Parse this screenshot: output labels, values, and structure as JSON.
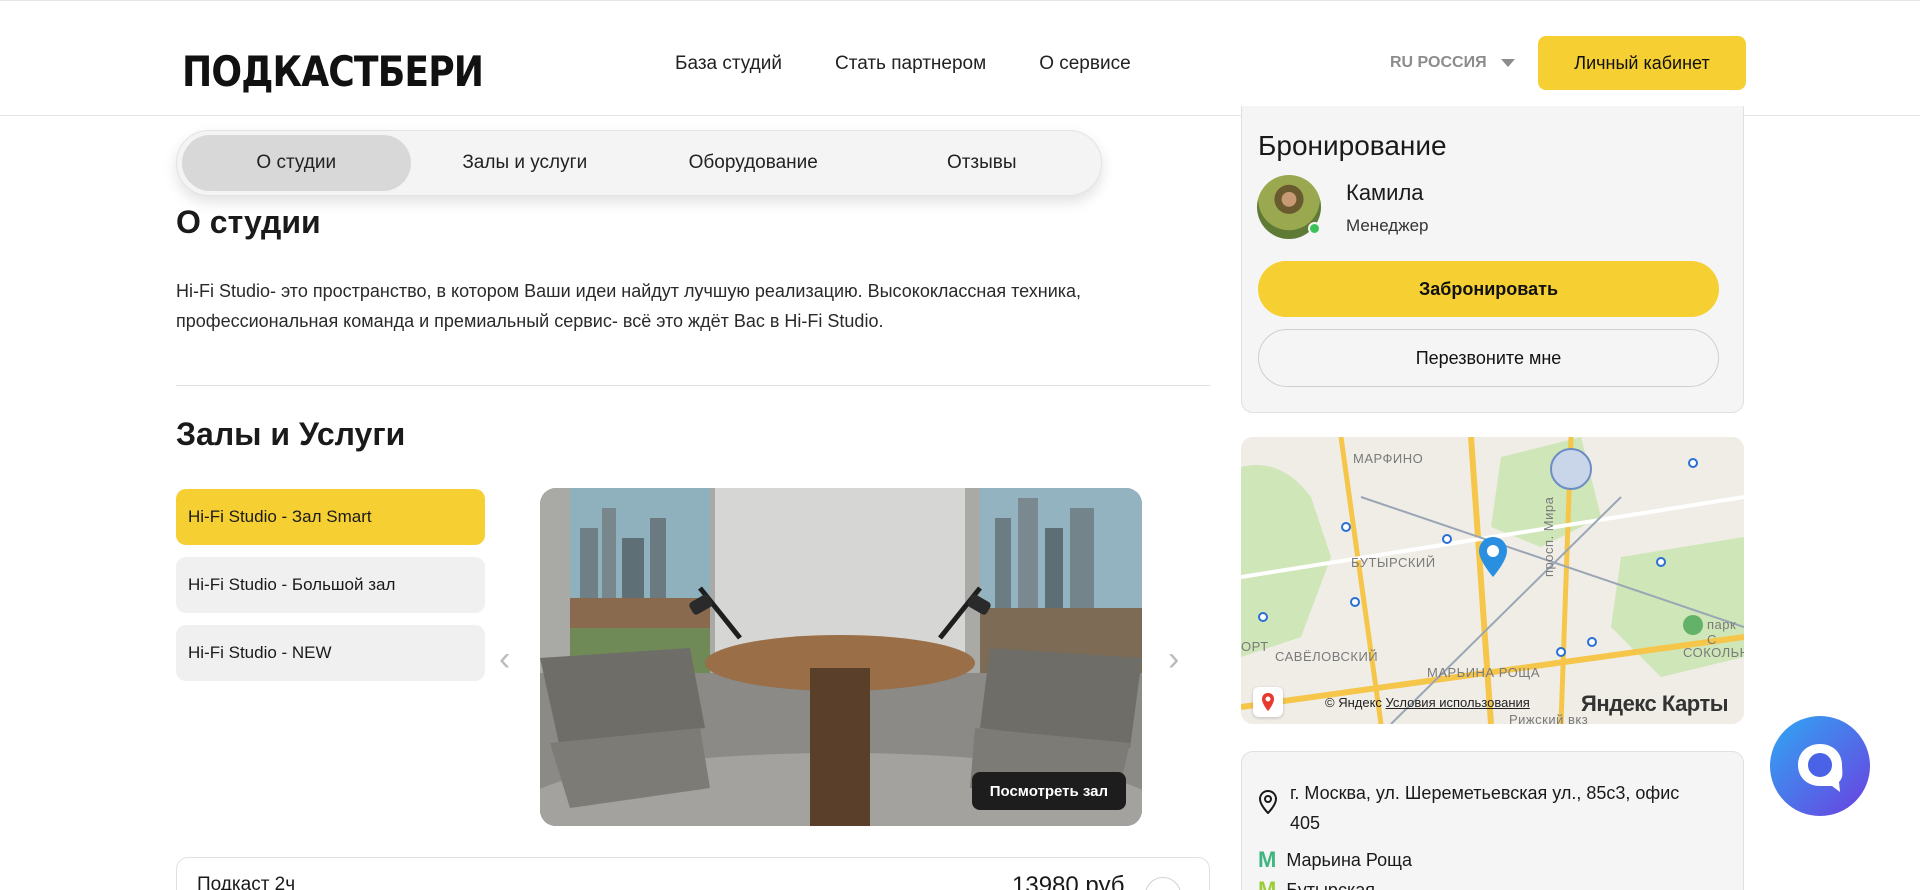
{
  "header": {
    "logo": "ПОДКАСТБЕРИ",
    "nav": [
      "База студий",
      "Стать партнером",
      "О сервисе"
    ],
    "lang": "RU РОССИЯ",
    "cabinet_label": "Личный кабинет"
  },
  "tabs": [
    {
      "label": "О студии",
      "active": true
    },
    {
      "label": "Залы и услуги",
      "active": false
    },
    {
      "label": "Оборудование",
      "active": false
    },
    {
      "label": "Отзывы",
      "active": false
    }
  ],
  "about": {
    "title": "О студии",
    "text": "Hi-Fi Studio- это пространство, в котором Ваши идеи найдут лучшую реализацию. Высококлассная техника, профессиональная команда и премиальный сервис- всё это ждёт Вас в Hi-Fi Studio."
  },
  "halls": {
    "title": "Залы и Услуги",
    "items": [
      {
        "label": "Hi-Fi Studio - Зал Smart",
        "active": true
      },
      {
        "label": "Hi-Fi Studio - Большой зал",
        "active": false
      },
      {
        "label": "Hi-Fi Studio - NEW",
        "active": false
      }
    ],
    "view_label": "Посмотреть зал",
    "arrow_left": "‹",
    "arrow_right": "›"
  },
  "price": {
    "name": "Подкаст 2ч",
    "value": "13980 руб"
  },
  "booking": {
    "title": "Бронирование",
    "manager_name": "Камила",
    "manager_role": "Менеджер",
    "book_label": "Забронировать",
    "call_label": "Перезвоните мне"
  },
  "map": {
    "labels": [
      "МАРФИНО",
      "БУТЫРСКИЙ",
      "САВЁЛОВСКИЙ",
      "МАРЬИНА РОЩА",
      "ОРТ",
      "СОКОЛЬНИ",
      "парк С",
      "просп. Мира",
      "Рижский вкз"
    ],
    "copyright": "© Яндекс",
    "terms": "Условия использования",
    "brand": "Яндекс Карты"
  },
  "address": {
    "text": "г. Москва, ул. Шереметьевская ул., 85с3, офис 405",
    "metro": [
      {
        "name": "Марьина Роща",
        "color": "#3fb57f"
      },
      {
        "name": "Бутырская",
        "color": "#9ccc3c"
      }
    ]
  },
  "colors": {
    "accent": "#f6d033",
    "dark": "#1d1d1d",
    "chat_start": "#2fa8f3",
    "chat_end": "#6b3fe0"
  }
}
